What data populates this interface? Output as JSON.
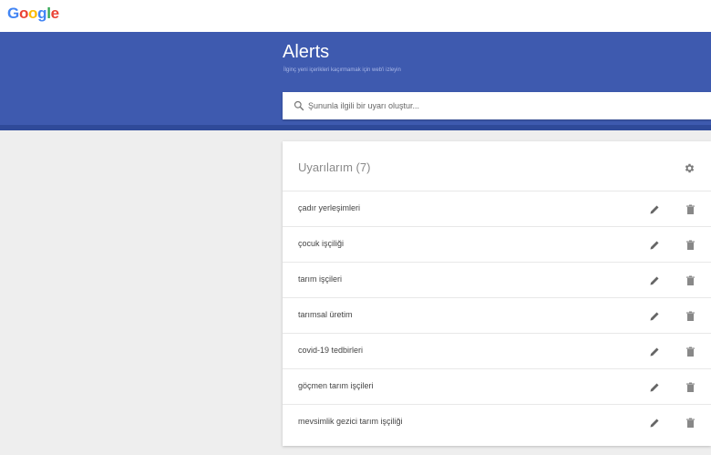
{
  "logo": {
    "letters": [
      "G",
      "o",
      "o",
      "g",
      "l",
      "e"
    ],
    "colors": [
      "#4285f4",
      "#ea4335",
      "#fbbc05",
      "#4285f4",
      "#34a853",
      "#ea4335"
    ]
  },
  "hero": {
    "title": "Alerts",
    "subtitle": "İlginç yeni içerikleri kaçırmamak için web'i izleyin",
    "color": "#3e5aaf"
  },
  "search": {
    "placeholder": "Şununla ilgili bir uyarı oluştur..."
  },
  "alerts": {
    "title": "Uyarılarım (7)",
    "items": [
      {
        "label": "çadır yerleşimleri"
      },
      {
        "label": "çocuk işçiliği"
      },
      {
        "label": "tarım işçileri"
      },
      {
        "label": "tarımsal üretim"
      },
      {
        "label": "covid-19 tedbirleri"
      },
      {
        "label": "göçmen tarım işçileri"
      },
      {
        "label": "mevsimlik gezici tarım işçiliği"
      }
    ]
  },
  "icons": {
    "search": "search-icon",
    "settings": "gear-icon",
    "edit": "pencil-icon",
    "delete": "trash-icon"
  }
}
